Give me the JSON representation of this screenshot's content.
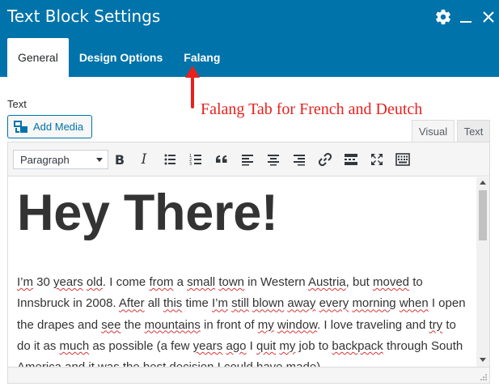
{
  "window": {
    "title": "Text Block Settings",
    "icons": [
      "gear-icon",
      "minimize-icon",
      "close-icon"
    ]
  },
  "tabs": [
    {
      "label": "General",
      "active": true
    },
    {
      "label": "Design Options",
      "active": false
    },
    {
      "label": "Falang",
      "active": false
    }
  ],
  "field": {
    "label": "Text"
  },
  "annotation": {
    "text": "Falang Tab for French and Deutch",
    "color": "#e8211d"
  },
  "add_media": {
    "label": "Add Media"
  },
  "editor_modes": [
    {
      "label": "Visual",
      "active": true
    },
    {
      "label": "Text",
      "active": false
    }
  ],
  "toolbar": {
    "format_select": "Paragraph",
    "bold_label": "B",
    "italic_label": "I",
    "buttons": [
      "bold",
      "italic",
      "bullet-list",
      "numbered-list",
      "blockquote",
      "align-left",
      "align-center",
      "align-right",
      "link",
      "read-more",
      "fullscreen",
      "toolbar-toggle"
    ]
  },
  "content": {
    "heading": "Hey There!",
    "paragraph_segments": [
      {
        "t": "I’m",
        "s": true
      },
      {
        "t": " 30 ",
        "s": false
      },
      {
        "t": "years",
        "s": true
      },
      {
        "t": " ",
        "s": false
      },
      {
        "t": "old",
        "s": true
      },
      {
        "t": ". I come ",
        "s": false
      },
      {
        "t": "from",
        "s": true
      },
      {
        "t": " a ",
        "s": false
      },
      {
        "t": "small",
        "s": true
      },
      {
        "t": " ",
        "s": false
      },
      {
        "t": "town",
        "s": true
      },
      {
        "t": " in Western ",
        "s": false
      },
      {
        "t": "Austria",
        "s": true
      },
      {
        "t": ", but ",
        "s": false
      },
      {
        "t": "moved",
        "s": true
      },
      {
        "t": " to Innsbruck in 2008. ",
        "s": false
      },
      {
        "t": "After",
        "s": true
      },
      {
        "t": " all ",
        "s": false
      },
      {
        "t": "this",
        "s": true
      },
      {
        "t": " time ",
        "s": false
      },
      {
        "t": "I’m",
        "s": true
      },
      {
        "t": " ",
        "s": false
      },
      {
        "t": "still",
        "s": true
      },
      {
        "t": " ",
        "s": false
      },
      {
        "t": "blown",
        "s": true
      },
      {
        "t": " ",
        "s": false
      },
      {
        "t": "away",
        "s": true
      },
      {
        "t": " ",
        "s": false
      },
      {
        "t": "every",
        "s": true
      },
      {
        "t": " ",
        "s": false
      },
      {
        "t": "morning",
        "s": true
      },
      {
        "t": " ",
        "s": false
      },
      {
        "t": "when",
        "s": true
      },
      {
        "t": " I open the drapes and ",
        "s": false
      },
      {
        "t": "see",
        "s": true
      },
      {
        "t": " the ",
        "s": false
      },
      {
        "t": "mountains",
        "s": true
      },
      {
        "t": " in front of ",
        "s": false
      },
      {
        "t": "my",
        "s": true
      },
      {
        "t": " ",
        "s": false
      },
      {
        "t": "window",
        "s": true
      },
      {
        "t": ". I love traveling and ",
        "s": false
      },
      {
        "t": "try",
        "s": true
      },
      {
        "t": " to do it as ",
        "s": false
      },
      {
        "t": "much",
        "s": true
      },
      {
        "t": " as possible (a few ",
        "s": false
      },
      {
        "t": "years",
        "s": true
      },
      {
        "t": " ",
        "s": false
      },
      {
        "t": "ago",
        "s": true
      },
      {
        "t": " I ",
        "s": false
      },
      {
        "t": "quit",
        "s": true
      },
      {
        "t": " ",
        "s": false
      },
      {
        "t": "my",
        "s": true
      },
      {
        "t": " job to ",
        "s": false
      },
      {
        "t": "backpack",
        "s": true
      },
      {
        "t": " through South America and it was the best decision I could have made).",
        "s": false
      }
    ]
  }
}
